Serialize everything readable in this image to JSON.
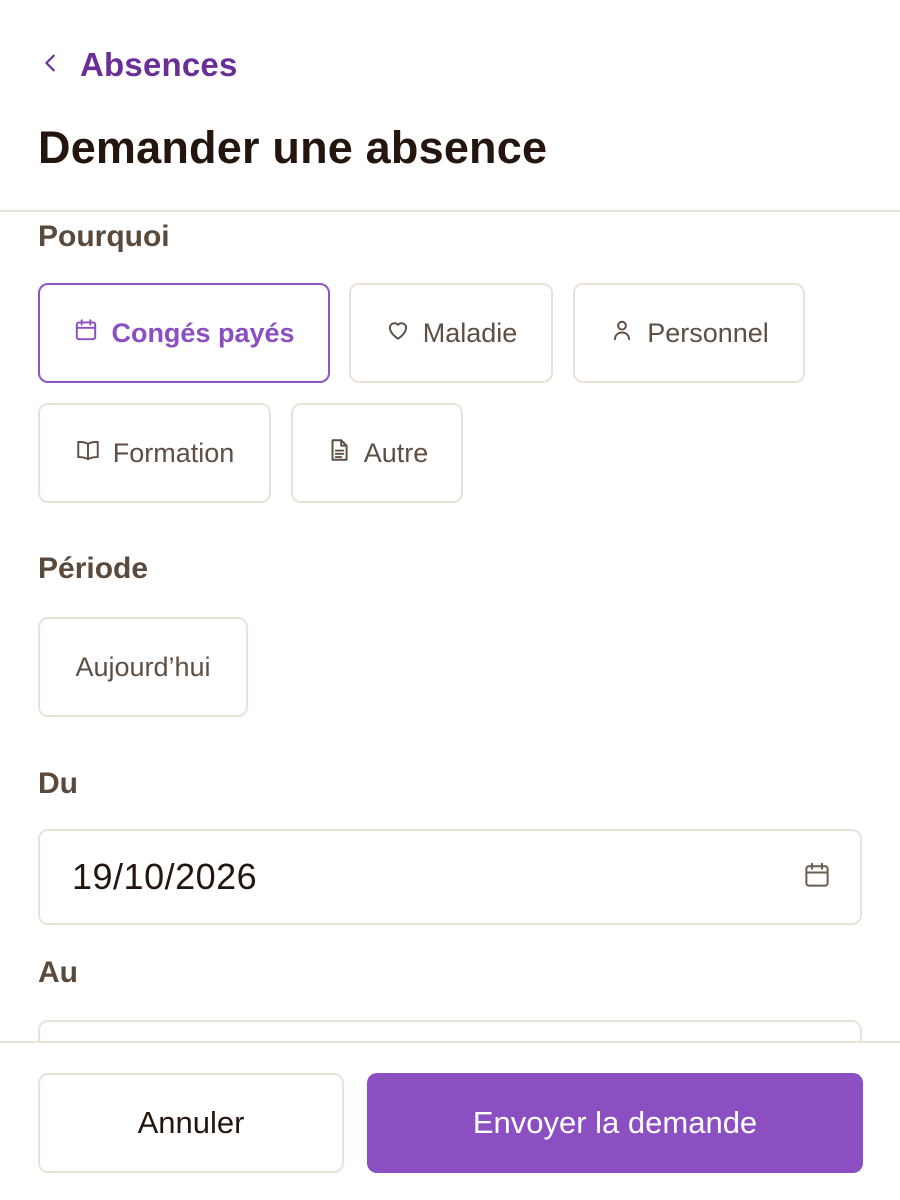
{
  "header": {
    "back_label": "Absences",
    "title": "Demander une absence"
  },
  "reason": {
    "label": "Pourquoi",
    "options": [
      {
        "label": "Congés payés",
        "icon": "calendar-icon",
        "selected": true
      },
      {
        "label": "Maladie",
        "icon": "heart-icon",
        "selected": false
      },
      {
        "label": "Personnel",
        "icon": "user-icon",
        "selected": false
      },
      {
        "label": "Formation",
        "icon": "book-icon",
        "selected": false
      },
      {
        "label": "Autre",
        "icon": "document-icon",
        "selected": false
      }
    ]
  },
  "period": {
    "label": "Période",
    "preset_label": "Aujourd’hui"
  },
  "from": {
    "label": "Du",
    "value": "19/10/2026"
  },
  "to": {
    "label": "Au"
  },
  "footer": {
    "cancel_label": "Annuler",
    "submit_label": "Envoyer la demande"
  },
  "colors": {
    "accent": "#8b4fc1",
    "back_link": "#6a2f97",
    "border": "#ebe2d7",
    "text_muted": "#5e4f42"
  }
}
